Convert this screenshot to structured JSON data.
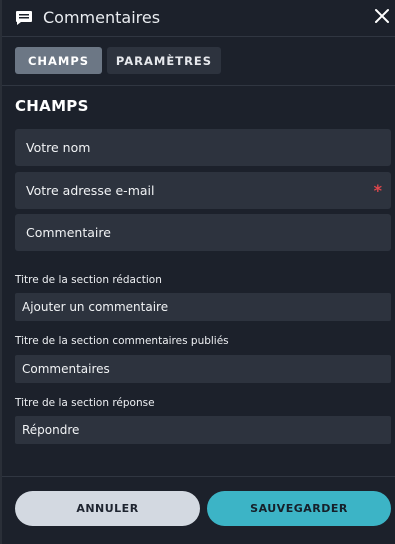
{
  "header": {
    "title": "Commentaires",
    "icon": "comment-icon"
  },
  "tabs": [
    {
      "label": "CHAMPS",
      "active": true
    },
    {
      "label": "PARAMÈTRES",
      "active": false
    }
  ],
  "section": {
    "title": "CHAMPS"
  },
  "fields": [
    {
      "label": "Votre nom",
      "required": false
    },
    {
      "label": "Votre adresse e-mail",
      "required": true,
      "required_mark": "*"
    },
    {
      "label": "Commentaire",
      "required": false
    }
  ],
  "inputs": [
    {
      "label": "Titre de la section rédaction",
      "value": "Ajouter un commentaire"
    },
    {
      "label": "Titre de la section commentaires publiés",
      "value": "Commentaires"
    },
    {
      "label": "Titre de la section réponse",
      "value": "Répondre"
    }
  ],
  "footer": {
    "cancel_label": "ANNULER",
    "save_label": "SAUVEGARDER"
  },
  "colors": {
    "background": "#1c212b",
    "field": "#2d333e",
    "accent": "#3cb4c6",
    "required": "#e0474c"
  }
}
